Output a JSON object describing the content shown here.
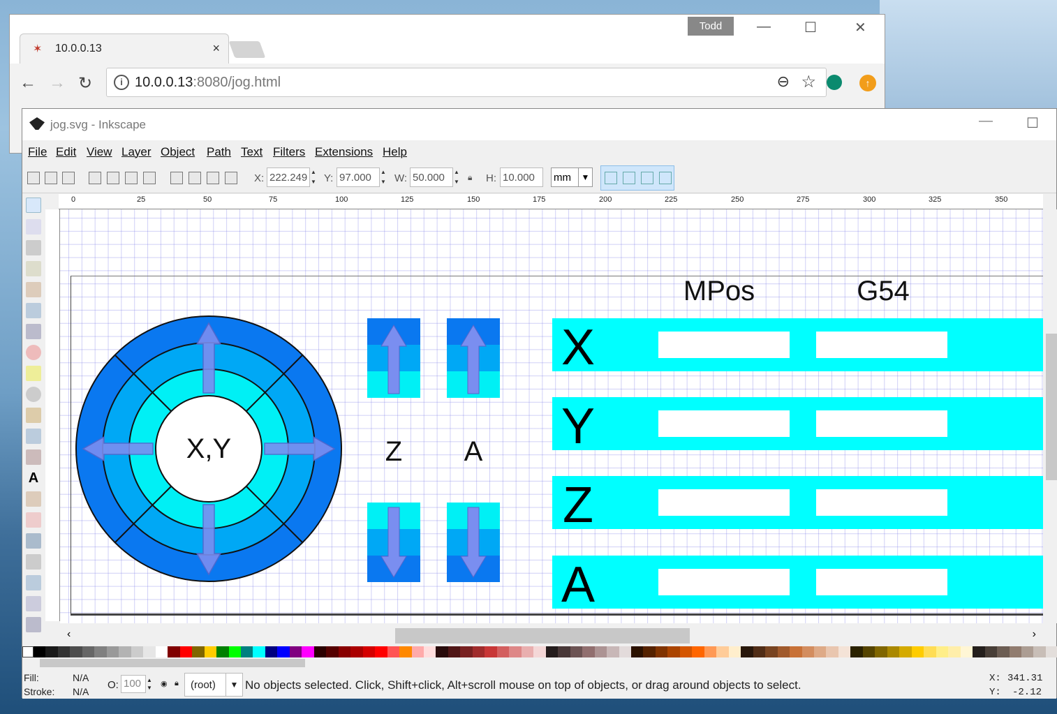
{
  "browser": {
    "tab_title": "10.0.0.13",
    "tab_close": "×",
    "user_badge": "Todd",
    "url_host": "10.0.0.13",
    "url_path": ":8080/jog.html",
    "min_glyph": "—",
    "max_glyph": "☐",
    "close_glyph": "✕"
  },
  "inkscape": {
    "window_title": "jog.svg - Inkscape",
    "menu": [
      "File",
      "Edit",
      "View",
      "Layer",
      "Object",
      "Path",
      "Text",
      "Filters",
      "Extensions",
      "Help"
    ],
    "toolbar": {
      "x_label": "X:",
      "x_value": "222.249",
      "y_label": "Y:",
      "y_value": "97.000",
      "w_label": "W:",
      "w_value": "50.000",
      "h_label": "H:",
      "h_value": "10.000",
      "unit": "mm"
    },
    "ruler_ticks": [
      "0",
      "25",
      "50",
      "75",
      "100",
      "125",
      "150",
      "175",
      "200",
      "225",
      "250",
      "275",
      "300",
      "325",
      "350"
    ],
    "canvas": {
      "header_mpos": "MPos",
      "header_g54": "G54",
      "xy_label": "X,Y",
      "z_label": "Z",
      "a_label": "A",
      "axes": [
        "X",
        "Y",
        "Z",
        "A"
      ]
    },
    "status": {
      "fill_label": "Fill:",
      "fill_value": "N/A",
      "stroke_label": "Stroke:",
      "stroke_value": "N/A",
      "opacity_label": "O:",
      "opacity_value": "100",
      "layer": "(root)",
      "message": "No objects selected. Click, Shift+click, Alt+scroll mouse on top of objects, or drag around objects to select.",
      "cursor_x_label": "X:",
      "cursor_x": "341.31",
      "cursor_y_label": "Y:",
      "cursor_y": "-2.12"
    }
  },
  "colors": {
    "ring_outer": "#0a78f0",
    "ring_middle": "#00a8f5",
    "ring_inner": "#00f0f5",
    "arrow": "#7a8ef0",
    "axis_bar": "#00ffff"
  }
}
